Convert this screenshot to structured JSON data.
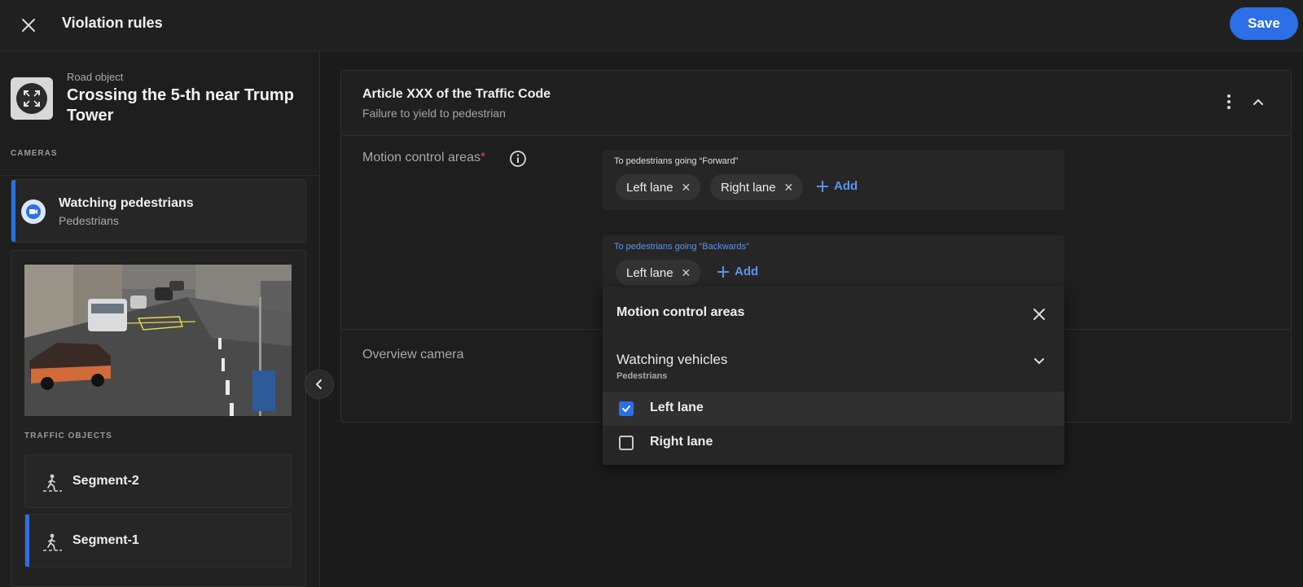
{
  "header": {
    "title": "Violation rules",
    "save_label": "Save",
    "accent_color": "#2c6fe6"
  },
  "sidebar": {
    "road_object_label": "Road object",
    "road_object_name": "Crossing the 5-th near Trump Tower",
    "cameras_caption": "CAMERAS",
    "camera": {
      "title": "Watching pedestrians",
      "subtitle": "Pedestrians"
    },
    "traffic_objects_caption": "TRAFFIC OBJECTS",
    "traffic_objects": [
      {
        "label": "Segment-2",
        "selected": false
      },
      {
        "label": "Segment-1",
        "selected": true
      }
    ]
  },
  "article": {
    "title": "Article XXX of the Traffic Code",
    "subtitle": "Failure to yield to pedestrian",
    "motion_label": "Motion control areas",
    "required_mark": "*",
    "overview_label": "Overview camera",
    "forward": {
      "caption": "To pedestrians going “Forward”",
      "chips": [
        "Left lane",
        "Right lane"
      ],
      "add_label": "Add"
    },
    "backwards": {
      "caption": "To pedestrians going “Backwards”",
      "chips": [
        "Left lane"
      ],
      "add_label": "Add"
    }
  },
  "dropdown": {
    "title": "Motion control areas",
    "camera_name": "Watching vehicles",
    "camera_sub": "Pedestrians",
    "options": [
      {
        "label": "Left lane",
        "checked": true
      },
      {
        "label": "Right lane",
        "checked": false
      }
    ]
  }
}
